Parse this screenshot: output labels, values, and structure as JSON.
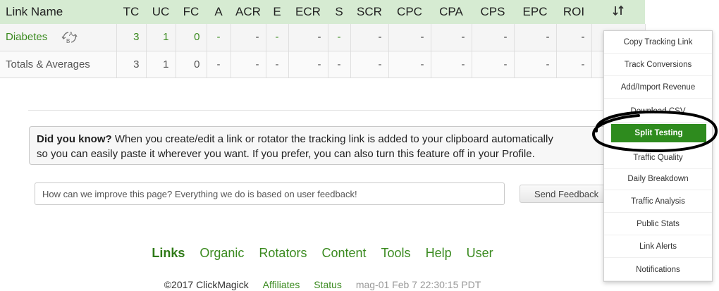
{
  "table": {
    "headers": [
      "Link Name",
      "TC",
      "UC",
      "FC",
      "A",
      "ACR",
      "E",
      "ECR",
      "S",
      "SCR",
      "CPC",
      "CPA",
      "CPS",
      "EPC",
      "ROI"
    ],
    "rows": [
      {
        "name": "Diabetes",
        "tc": "3",
        "uc": "1",
        "fc": "0",
        "a": "-",
        "acr": "-",
        "e": "-",
        "ecr": "-",
        "s": "-",
        "scr": "-",
        "cpc": "-",
        "cpa": "-",
        "cps": "-",
        "epc": "-",
        "roi": "-"
      },
      {
        "name": "Totals & Averages",
        "tc": "3",
        "uc": "1",
        "fc": "0",
        "a": "-",
        "acr": "-",
        "e": "-",
        "ecr": "-",
        "s": "-",
        "scr": "-",
        "cpc": "-",
        "cpa": "-",
        "cps": "-",
        "epc": "-",
        "roi": "-"
      }
    ],
    "split_icon_letters": [
      "A",
      "B"
    ]
  },
  "did_you_know": {
    "label": "Did you know?",
    "line1": " When you create/edit a link or rotator the tracking link is added to your clipboard automatically",
    "line2": "so you can easily paste it wherever you want. If you prefer, you can also turn this feature off in your Profile."
  },
  "feedback": {
    "placeholder": "How can we improve this page? Everything we do is based on user feedback!",
    "button": "Send Feedback"
  },
  "footer": {
    "nav": [
      "Links",
      "Organic",
      "Rotators",
      "Content",
      "Tools",
      "Help",
      "User"
    ],
    "active": "Links",
    "copyright": "©2017 ClickMagick",
    "affiliates": "Affiliates",
    "status": "Status",
    "server": "mag-01 Feb 7 22:30:15 PDT"
  },
  "dropdown": {
    "items": [
      "Copy Tracking Link",
      "Track Conversions",
      "Add/Import Revenue",
      "Download CSV",
      "Split Testing",
      "Traffic Quality",
      "Daily Breakdown",
      "Traffic Analysis",
      "Public Stats",
      "Link Alerts",
      "Notifications"
    ],
    "highlighted": "Split Testing",
    "highlight_color": "#2e8b1e",
    "annotation_color": "#000000"
  },
  "colors": {
    "header_bg": "#d6ebd2",
    "link_green": "#3a8a1f"
  }
}
